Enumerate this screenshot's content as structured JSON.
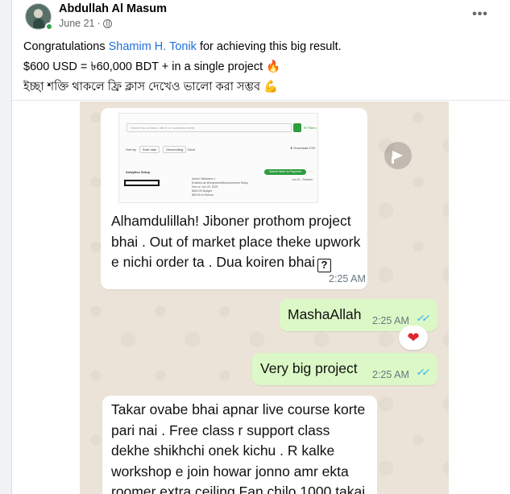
{
  "post": {
    "author": "Abdullah Al Masum",
    "date": "June 21",
    "separator": "·",
    "more_label": "•••",
    "text": {
      "line1_prefix": "Congratulations ",
      "mention": "Shamim H. Tonik",
      "line1_suffix": " for achieving this big result.",
      "line2": "$600 USD = ৳60,000 BDT + in a single project 🔥",
      "line3": "ইচ্ছা শক্তি থাকলে ফ্রি ক্লাস দেখেও ভালো করা সম্ভব 💪"
    },
    "icons": {
      "privacy": "globe-icon",
      "more": "more-options-icon"
    }
  },
  "chat": {
    "screenshot": {
      "search_placeholder": "Search by contract, client, or company name",
      "filters": "☰ Filters",
      "sort_by_label": "Sort by",
      "sort_by_value": "Start date",
      "order_value": "Descending",
      "clear_label": "Clear",
      "download_label": "⬇ Download CSV",
      "analytics_title": "Analytics Setup",
      "milestone_line1": "Active: Milestone 1",
      "milestone_line2": "Enabled as Wordpress/Woocommerce Setup",
      "milestone_line3": "Due on Jun 20, 2023",
      "milestone_line4": "$600.00 Budget",
      "milestone_line5": "$90.00 In Escrow",
      "submit_label": "Submit Work for Payment",
      "date_range": "Jun 20 - Present"
    },
    "messages": [
      {
        "direction": "incoming",
        "lines": [
          "Alhamdulillah! Jiboner prothom project",
          "bhai . Out of market place theke upwork",
          "e nichi order ta . Dua koiren bhai"
        ],
        "trailing_glyph": "?",
        "time": "2:25 AM"
      },
      {
        "direction": "outgoing",
        "text": "MashaAllah",
        "time": "2:25 AM",
        "ticks": "✓✓",
        "reaction": "❤"
      },
      {
        "direction": "outgoing",
        "text": "Very big project",
        "time": "2:25 AM",
        "ticks": "✓✓"
      },
      {
        "direction": "incoming",
        "lines": [
          "Takar ovabe bhai apnar live course korte",
          "pari nai . Free class r support class",
          "dekhe shikhchi onek kichu . R kalke",
          "workshop e join howar jonno amr ekta",
          "roomer extra ceiling Fan chilo 1000 takai"
        ]
      }
    ],
    "colors": {
      "incoming_bubble": "#ffffff",
      "outgoing_bubble": "#dcf8c6",
      "wallpaper": "#ebe3d8",
      "read_ticks": "#53bdeb",
      "mention": "#216fdb"
    }
  }
}
